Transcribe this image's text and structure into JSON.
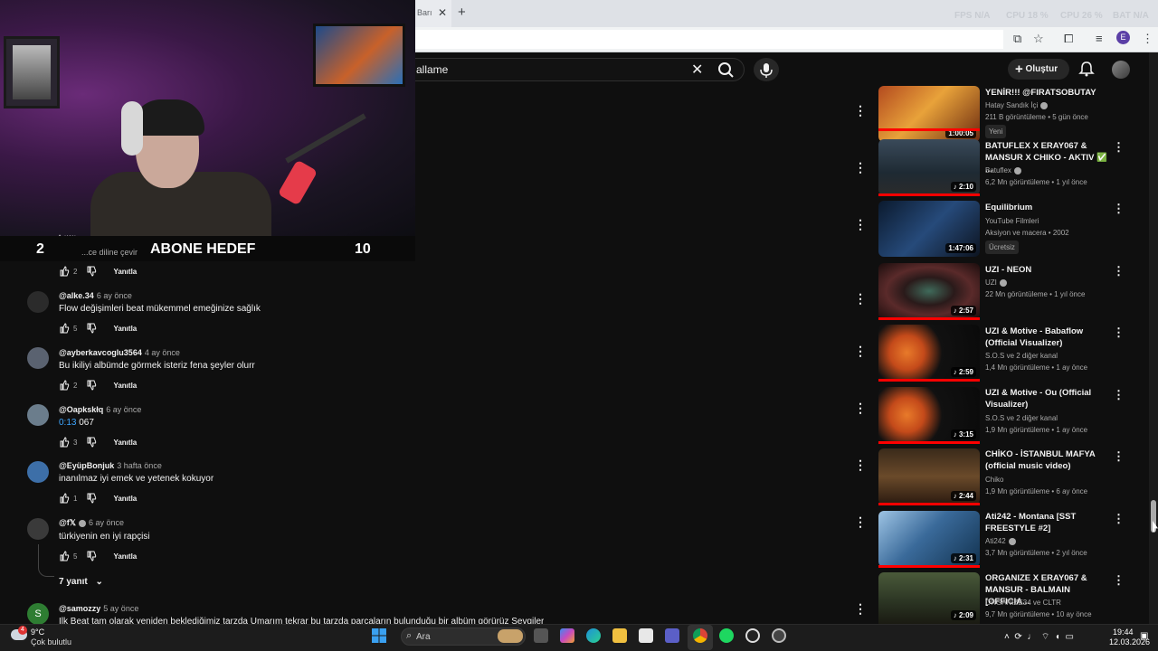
{
  "browser": {
    "tab_title": "Barı",
    "tab_close": "✕",
    "new_tab": "+",
    "overlay": {
      "fps_label": "FPS",
      "fps_value": "N/A",
      "cpu1_label": "CPU",
      "cpu1_value": "18 %",
      "cpu2_label": "CPU",
      "cpu2_value": "26 %",
      "bat_label": "BAT",
      "bat_value": "N/A"
    },
    "profile_initial": "E"
  },
  "youtube": {
    "search_value": "allame",
    "create_label": "Oluştur"
  },
  "stream_overlay": {
    "goal_left": "2",
    "goal_text": "ABONE HEDEF",
    "goal_right": "10",
    "translate_link": "...ce diline çevir",
    "partial_name": "t..ww"
  },
  "comments": [
    {
      "likes": "2",
      "reply": "Yanıtla"
    },
    {
      "author": "@alke.34",
      "time": "6 ay önce",
      "text": "Flow değişimleri beat  mükemmel emeğinize sağlık",
      "likes": "5",
      "reply": "Yanıtla"
    },
    {
      "author": "@ayberkavcoglu3564",
      "time": "4 ay önce",
      "text": "Bu ikiliyi albümde görmek isteriz fena şeyler olurr",
      "likes": "2",
      "reply": "Yanıtla"
    },
    {
      "author": "@Oapkskłq",
      "time": "6 ay önce",
      "timestamp": "0:13",
      "text": "067",
      "likes": "3",
      "reply": "Yanıtla"
    },
    {
      "author": "@EyüpBonjuk",
      "time": "3 hafta önce",
      "text": "inanılmaz iyi emek ve yetenek kokuyor",
      "likes": "1",
      "reply": "Yanıtla"
    },
    {
      "author": "@f𝕏",
      "time": "6 ay önce",
      "text": "türkiyenin en iyi rapçisi",
      "likes": "5",
      "reply": "Yanıtla",
      "replies": "7 yanıt"
    },
    {
      "author": "@samozzy",
      "time": "5 ay önce",
      "avatar_letter": "S",
      "text": "İlk Beat tam olarak yeniden beklediğimiz tarzda Umarım tekrar bu tarzda parçaların bulunduğu bir albüm görürüz Sevgiler"
    }
  ],
  "sidebar": [
    {
      "title": "YENİR!!! @FIRATSOBUTAY",
      "channel": "Hatay Sandık İçi",
      "meta": "211 B görüntüleme • 5 gün önce",
      "badge": "Yeni",
      "duration": "1:00:05"
    },
    {
      "title": "BATUFLEX X ERAY067 & MANSUR X CHIKO - AKTIV ✅ ...",
      "channel": "Batuflex",
      "meta": "6,2 Mn görüntüleme • 1 yıl önce",
      "duration": "2:10"
    },
    {
      "title": "Equilibrium",
      "channel": "YouTube Filmleri",
      "meta": "Aksiyon ve macera • 2002",
      "badge": "Ücretsiz",
      "duration": "1:47:06"
    },
    {
      "title": "UZI - NEON",
      "channel": "UZI",
      "meta": "22 Mn görüntüleme • 1 yıl önce",
      "duration": "2:57"
    },
    {
      "title": "UZI & Motive - Babaflow (Official Visualizer)",
      "channel": "S.O.S ve 2 diğer kanal",
      "meta": "1,4 Mn görüntüleme • 1 ay önce",
      "duration": "2:59"
    },
    {
      "title": "UZI & Motive - Ou (Official Visualizer)",
      "channel": "S.O.S ve 2 diğer kanal",
      "meta": "1,9 Mn görüntüleme • 1 ay önce",
      "duration": "3:15"
    },
    {
      "title": "CHİKO - İSTANBUL MAFYA (official music video)",
      "channel": "Chiko",
      "meta": "1,9 Mn görüntüleme • 6 ay önce",
      "duration": "2:44"
    },
    {
      "title": "Ati242 - Montana [SST FREESTYLE #2]",
      "channel": "Ati242",
      "meta": "3,7 Mn görüntüleme • 2 yıl önce",
      "duration": "2:31"
    },
    {
      "title": "ORGANIZE X ERAY067 & MANSUR - BALMAIN [OFFICIA...",
      "channel": "ORGANIZE34 ve CLTR",
      "meta": "9,7 Mn görüntüleme • 10 ay önce",
      "duration": "2:09"
    }
  ],
  "taskbar": {
    "weather_badge": "4",
    "weather_temp": "9°C",
    "weather_desc": "Çok bulutlu",
    "search_placeholder": "Ara",
    "time": "19:44",
    "date": "12.03.2026"
  },
  "colors": {
    "accent": "#3ea6ff",
    "yt_red": "#ff0000",
    "background": "#0f0f0f"
  }
}
